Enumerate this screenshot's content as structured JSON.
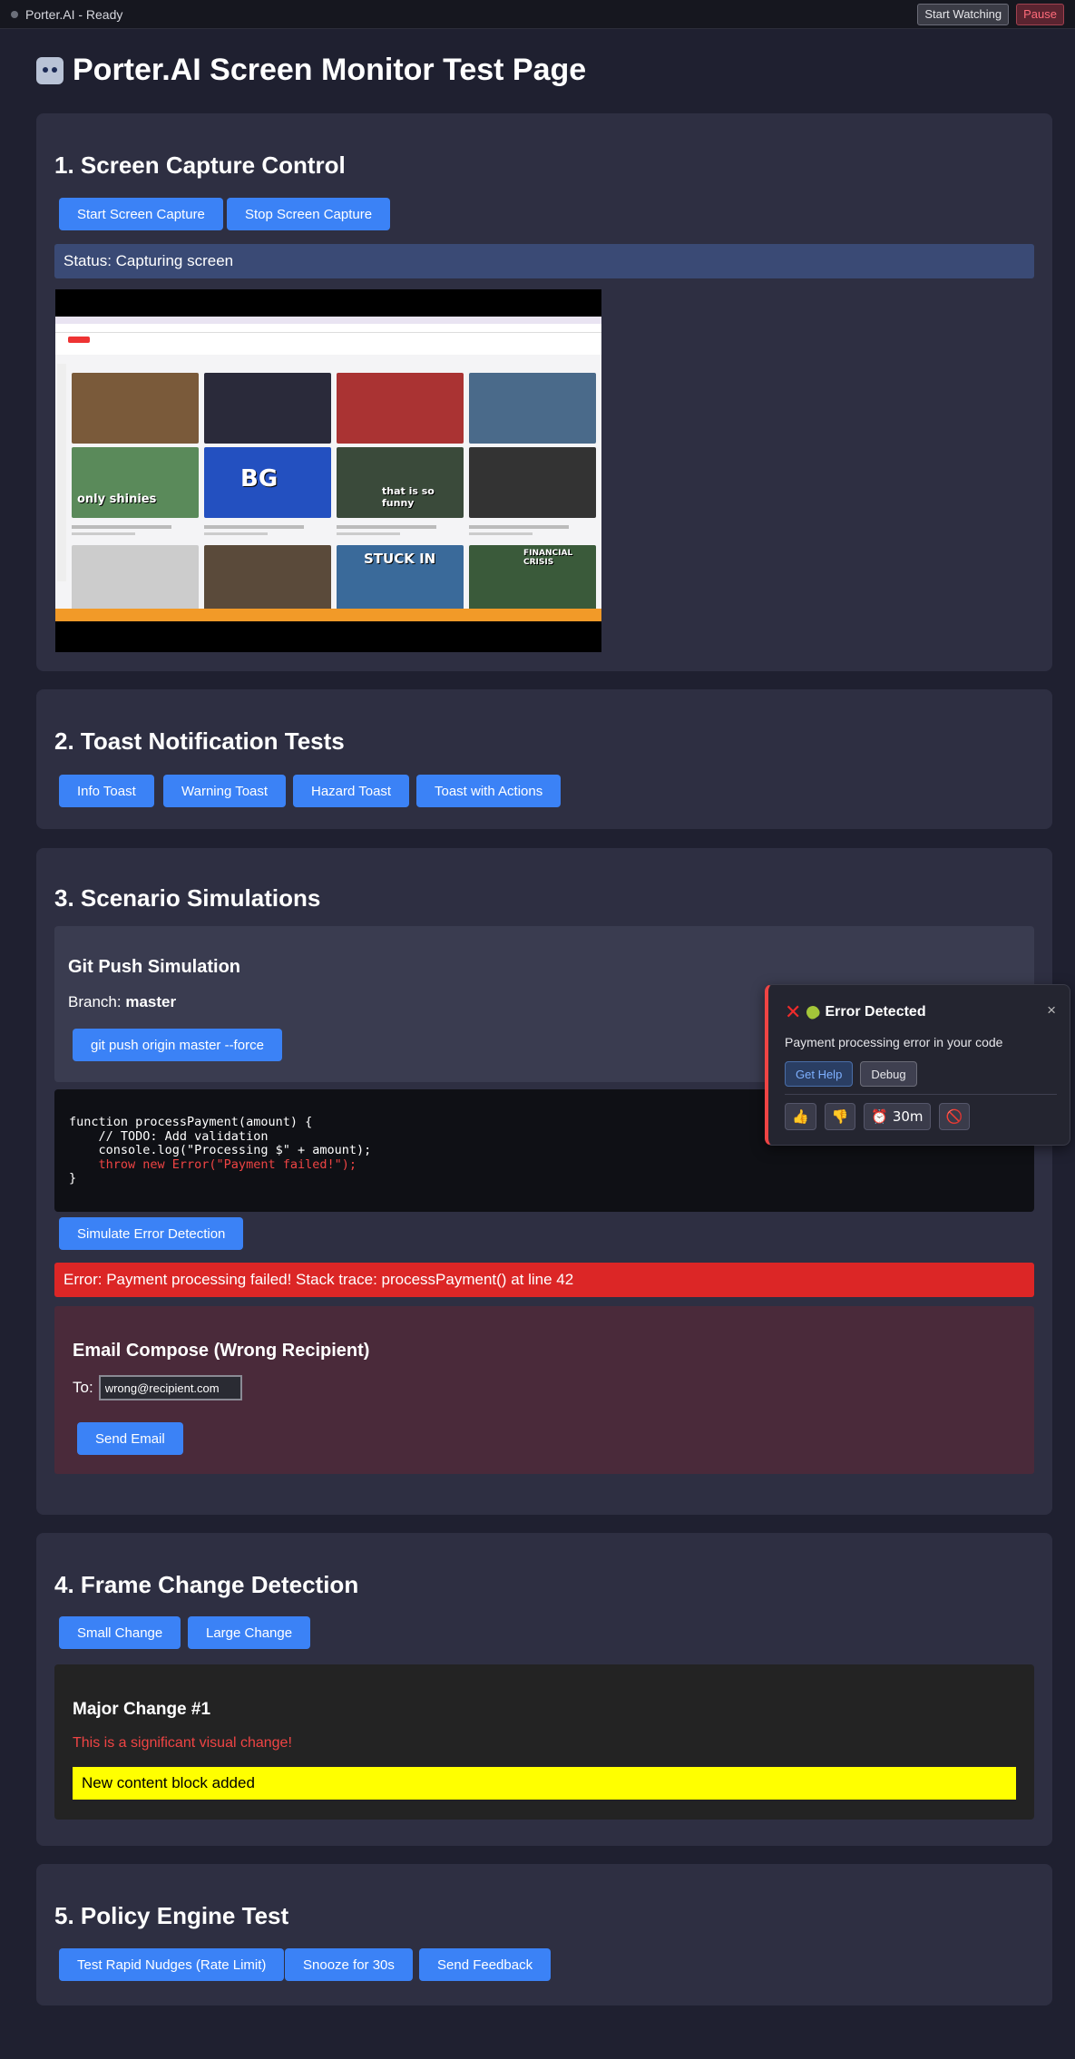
{
  "topbar": {
    "status": "Porter.AI - Ready",
    "start_watching": "Start Watching",
    "pause": "Pause"
  },
  "page": {
    "title": "Porter.AI Screen Monitor Test Page",
    "title_icon": "robot-icon"
  },
  "screen_capture": {
    "heading": "1. Screen Capture Control",
    "start_button": "Start Screen Capture",
    "stop_button": "Stop Screen Capture",
    "status": "Status: Capturing screen"
  },
  "toast_tests": {
    "heading": "2. Toast Notification Tests",
    "buttons": [
      "Info Toast",
      "Warning Toast",
      "Hazard Toast",
      "Toast with Actions"
    ]
  },
  "scenarios": {
    "heading": "3. Scenario Simulations",
    "git": {
      "title": "Git Push Simulation",
      "branch_label": "Branch:",
      "branch_value": "master",
      "push_button": "git push origin master --force"
    },
    "code": {
      "line1": "function processPayment(amount) {",
      "line2": "    // TODO: Add validation",
      "line3": "    console.log(\"Processing $\" + amount);",
      "line4": "    throw new Error(\"Payment failed!\");",
      "line5": "}"
    },
    "simulate_button": "Simulate Error Detection",
    "error_message": "Error: Payment processing failed! Stack trace: processPayment() at line 42",
    "email": {
      "title": "Email Compose (Wrong Recipient)",
      "to_label": "To:",
      "to_value": "wrong@recipient.com",
      "send_button": "Send Email"
    }
  },
  "frame_change": {
    "heading": "4. Frame Change Detection",
    "small_button": "Small Change",
    "large_button": "Large Change",
    "box_title": "Major Change #1",
    "box_red_text": "This is a significant visual change!",
    "box_yellow_text": "New content block added"
  },
  "policy": {
    "heading": "5. Policy Engine Test",
    "buttons": [
      "Test Rapid Nudges (Rate Limit)",
      "Snooze for 30s",
      "Send Feedback"
    ]
  },
  "toast": {
    "title": "Error Detected",
    "close": "×",
    "message": "Payment processing error in your code",
    "get_help": "Get Help",
    "debug": "Debug",
    "thumbs_up": "👍",
    "thumbs_down": "👎",
    "snooze": "⏰ 30m",
    "block": "🚫"
  },
  "colors": {
    "accent": "#3b82f6",
    "error": "#dc2626",
    "background": "#1f2030"
  }
}
